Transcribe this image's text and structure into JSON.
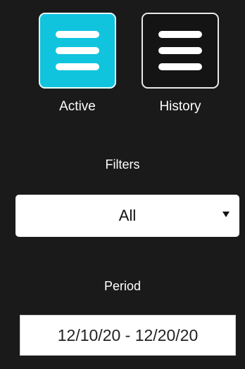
{
  "view_toggle": {
    "active": {
      "label": "Active",
      "icon": "list-icon",
      "selected": true,
      "color": "#11c4dd"
    },
    "history": {
      "label": "History",
      "icon": "list-icon",
      "selected": false
    }
  },
  "filters": {
    "label": "Filters",
    "selected": "All",
    "caret_icon": "caret-down-icon"
  },
  "period": {
    "label": "Period",
    "value": "12/10/20 - 12/20/20"
  },
  "colors": {
    "background": "#1a1a1a",
    "accent": "#11c4dd",
    "text": "#ffffff"
  }
}
